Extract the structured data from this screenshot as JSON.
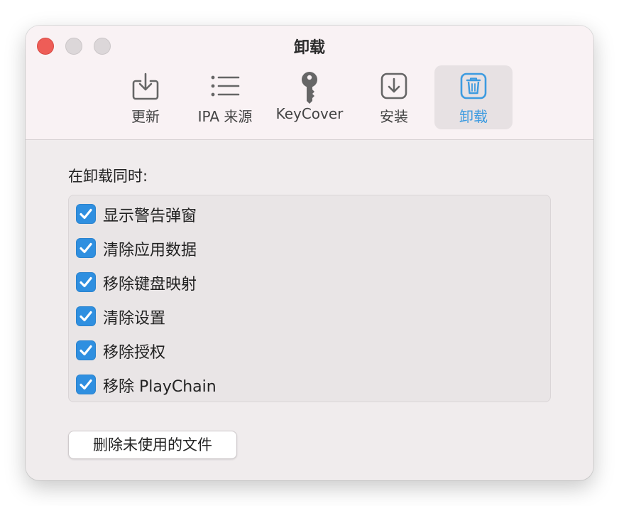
{
  "window": {
    "title": "卸载"
  },
  "toolbar": {
    "tabs": [
      {
        "label": "更新",
        "icon": "download-tray-icon",
        "selected": false
      },
      {
        "label": "IPA 来源",
        "icon": "list-icon",
        "selected": false
      },
      {
        "label": "KeyCover",
        "icon": "key-icon",
        "selected": false
      },
      {
        "label": "安装",
        "icon": "install-arrow-icon",
        "selected": false
      },
      {
        "label": "卸载",
        "icon": "trash-icon",
        "selected": true
      }
    ]
  },
  "content": {
    "section_label": "在卸载同时:",
    "options": [
      {
        "label": "显示警告弹窗",
        "checked": true
      },
      {
        "label": "清除应用数据",
        "checked": true
      },
      {
        "label": "移除键盘映射",
        "checked": true
      },
      {
        "label": "清除设置",
        "checked": true
      },
      {
        "label": "移除授权",
        "checked": true
      },
      {
        "label": "移除 PlayChain",
        "checked": true
      }
    ],
    "delete_button_label": "删除未使用的文件"
  },
  "colors": {
    "accent": "#3d9be0",
    "checkbox": "#2f8fe0",
    "close_button": "#ee5d57"
  }
}
